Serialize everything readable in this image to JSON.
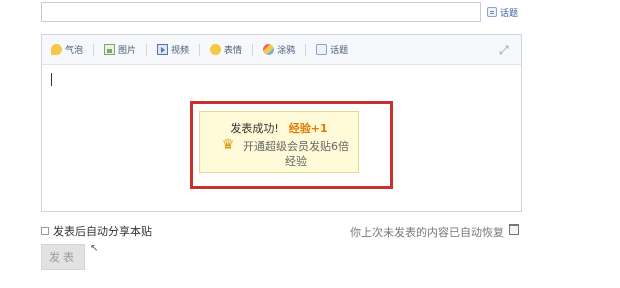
{
  "header": {
    "title_value": "",
    "topic_label": "话题"
  },
  "toolbar": {
    "items": [
      {
        "label": "气泡",
        "icon": "bubble-icon"
      },
      {
        "label": "图片",
        "icon": "image-icon"
      },
      {
        "label": "视频",
        "icon": "video-icon"
      },
      {
        "label": "表情",
        "icon": "emoji-icon"
      },
      {
        "label": "涂鸦",
        "icon": "doodle-icon"
      },
      {
        "label": "话题",
        "icon": "topic-icon"
      }
    ],
    "fullscreen_icon": "expand-icon"
  },
  "popup": {
    "title": "发表成功!",
    "exp": "经验+1",
    "promo_line1": "开通超级会员发贴6倍",
    "promo_line2": "经验"
  },
  "footer": {
    "share_label": "发表后自动分享本贴",
    "restore_note": "你上次未发表的内容已自动恢复",
    "submit_label": "发表"
  },
  "colors": {
    "highlight_border": "#c9312f",
    "popup_bg": "#fffbd8",
    "exp_color": "#e67a00"
  }
}
